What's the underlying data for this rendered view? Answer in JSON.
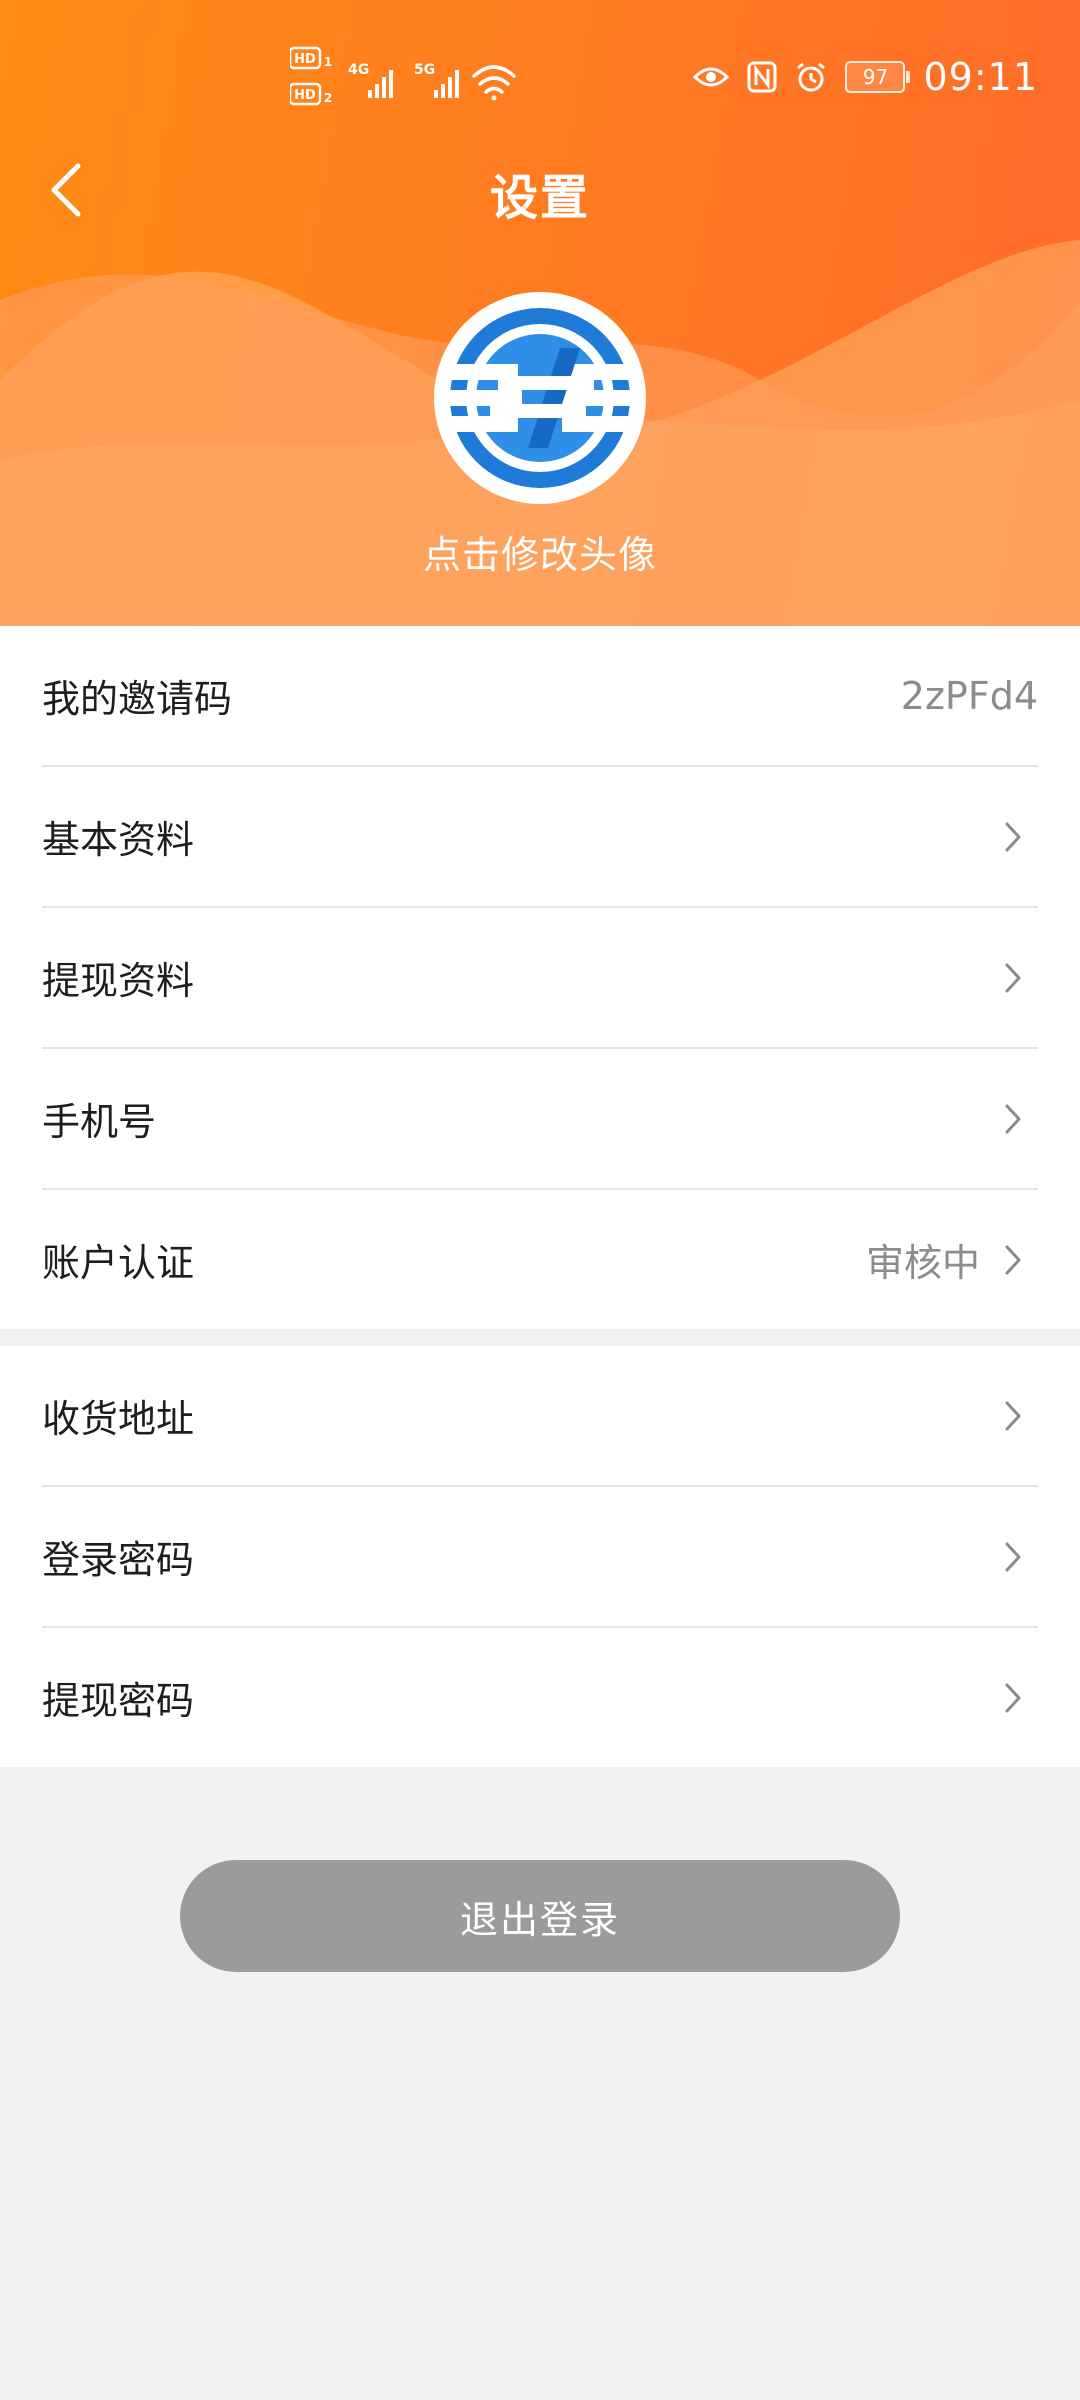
{
  "status_bar": {
    "time": "09:11",
    "battery": "97",
    "sim1_badge": "HD",
    "sim1_index": "1",
    "sim2_badge": "HD",
    "sim2_index": "2",
    "network1": "4G",
    "network2": "5G",
    "icons": [
      "hd-icon",
      "signal-icon",
      "wifi-icon",
      "eye-icon",
      "nfc-icon",
      "alarm-icon",
      "battery-icon"
    ]
  },
  "nav": {
    "title": "设置",
    "back_icon": "chevron-left-icon"
  },
  "profile": {
    "caption": "点击修改头像",
    "avatar_icon": "logo-icon"
  },
  "settings_group_1": {
    "items": [
      {
        "label": "我的邀请码",
        "value": "2zPFd4"
      },
      {
        "label": "基本资料",
        "value": ""
      },
      {
        "label": "提现资料",
        "value": ""
      },
      {
        "label": "手机号",
        "value": ""
      },
      {
        "label": "账户认证",
        "value": "审核中"
      }
    ]
  },
  "settings_group_2": {
    "items": [
      {
        "label": "收货地址"
      },
      {
        "label": "登录密码"
      },
      {
        "label": "提现密码"
      }
    ]
  },
  "logout": {
    "label": "退出登录"
  },
  "colors": {
    "accent": "#ff7a22",
    "logout_bg": "#9b9b9b",
    "page_bg": "#f1f1f1",
    "logo_blue": "#1f7ad8"
  }
}
